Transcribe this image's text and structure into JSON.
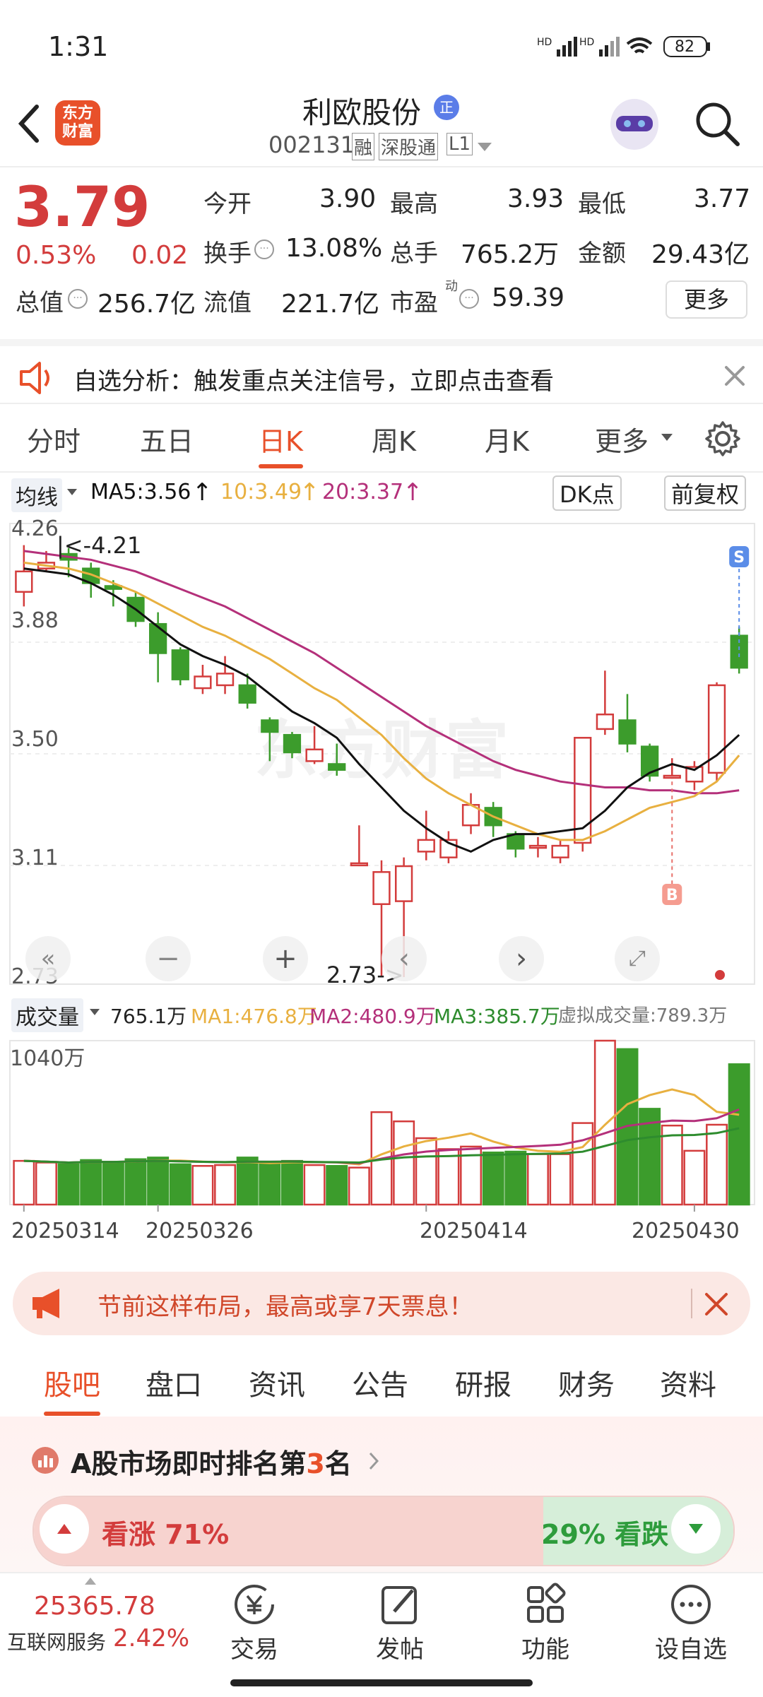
{
  "status_bar": {
    "time": "1:31",
    "signal1": "HD",
    "signal2": "HD",
    "battery": "82"
  },
  "header": {
    "back_icon": "back-arrow-icon",
    "app_logo": "东方财富",
    "stock_name": "利欧股份",
    "name_badge": "正",
    "code": "002131",
    "tags": [
      "融",
      "深股通",
      "L1"
    ],
    "search_icon": "search-icon"
  },
  "quote": {
    "price": "3.79",
    "change_pct": "0.53%",
    "change_abs": "0.02",
    "fields": [
      {
        "label": "今开",
        "value": "3.90",
        "color": "red"
      },
      {
        "label": "最高",
        "value": "3.93",
        "color": "red"
      },
      {
        "label": "最低",
        "value": "3.77",
        "color": "black"
      },
      {
        "label": "换手",
        "value": "13.08%",
        "color": "black"
      },
      {
        "label": "总手",
        "value": "765.2万",
        "color": "black"
      },
      {
        "label": "金额",
        "value": "29.43亿",
        "color": "black"
      },
      {
        "label": "总值",
        "value": "256.7亿",
        "color": "black"
      },
      {
        "label": "流值",
        "value": "221.7亿",
        "color": "black"
      },
      {
        "label": "市盈",
        "value": "59.39",
        "color": "black"
      }
    ],
    "pe_sup": "动",
    "more_label": "更多"
  },
  "analysis_banner": {
    "text": "自选分析：触发重点关注信号，立即点击查看"
  },
  "ktabs": {
    "items": [
      "分时",
      "五日",
      "日K",
      "周K",
      "月K",
      "更多"
    ],
    "active": "日K"
  },
  "ma_row": {
    "selector": "均线",
    "ma5": "MA5:3.56",
    "ma10": "10:3.49",
    "ma20": "20:3.37",
    "dk": "DK点",
    "fq": "前复权"
  },
  "chart_labels": {
    "y_ticks": [
      "4.26",
      "3.88",
      "3.50",
      "3.11",
      "2.73"
    ],
    "high_note": "4.21",
    "low_note": "2.73->",
    "sell_marker": "S",
    "buy_marker": "B"
  },
  "vol_row": {
    "selector": "成交量",
    "vol": "765.1万",
    "ma1": "MA1:476.8万",
    "ma2": "MA2:480.9万",
    "ma3": "MA3:385.7万",
    "virtual": "虚拟成交量:789.3万",
    "vol_tick": "1040万"
  },
  "dates": [
    "20250314",
    "20250326",
    "20250414",
    "20250430"
  ],
  "colors": {
    "up": "#d33c3c",
    "down": "#3c9c2c",
    "ma5": "#111111",
    "ma10": "#e8b040",
    "ma20": "#b4307a",
    "accent": "#e8502a"
  },
  "chart_data": {
    "type": "candlestick",
    "ylim": [
      2.73,
      4.26
    ],
    "candles": [
      {
        "o": 4.05,
        "c": 4.12,
        "h": 4.21,
        "l": 4.0
      },
      {
        "o": 4.13,
        "c": 4.15,
        "h": 4.19,
        "l": 4.12
      },
      {
        "o": 4.18,
        "c": 4.16,
        "h": 4.2,
        "l": 4.1
      },
      {
        "o": 4.13,
        "c": 4.08,
        "h": 4.15,
        "l": 4.03
      },
      {
        "o": 4.07,
        "c": 4.06,
        "h": 4.09,
        "l": 4.0
      },
      {
        "o": 4.03,
        "c": 3.95,
        "h": 4.05,
        "l": 3.93
      },
      {
        "o": 3.94,
        "c": 3.84,
        "h": 3.98,
        "l": 3.74
      },
      {
        "o": 3.85,
        "c": 3.75,
        "h": 3.86,
        "l": 3.73
      },
      {
        "o": 3.72,
        "c": 3.76,
        "h": 3.8,
        "l": 3.7
      },
      {
        "o": 3.73,
        "c": 3.77,
        "h": 3.83,
        "l": 3.7
      },
      {
        "o": 3.73,
        "c": 3.67,
        "h": 3.77,
        "l": 3.65
      },
      {
        "o": 3.61,
        "c": 3.57,
        "h": 3.62,
        "l": 3.47
      },
      {
        "o": 3.56,
        "c": 3.5,
        "h": 3.57,
        "l": 3.48
      },
      {
        "o": 3.47,
        "c": 3.51,
        "h": 3.59,
        "l": 3.46
      },
      {
        "o": 3.46,
        "c": 3.44,
        "h": 3.53,
        "l": 3.42
      },
      {
        "o": 3.12,
        "c": 3.12,
        "h": 3.25,
        "l": 3.11
      },
      {
        "o": 2.98,
        "c": 3.09,
        "h": 3.13,
        "l": 2.73
      },
      {
        "o": 2.99,
        "c": 3.11,
        "h": 3.14,
        "l": 2.73
      },
      {
        "o": 3.16,
        "c": 3.2,
        "h": 3.3,
        "l": 3.13
      },
      {
        "o": 3.14,
        "c": 3.2,
        "h": 3.23,
        "l": 3.12
      },
      {
        "o": 3.25,
        "c": 3.32,
        "h": 3.36,
        "l": 3.22
      },
      {
        "o": 3.31,
        "c": 3.25,
        "h": 3.33,
        "l": 3.21
      },
      {
        "o": 3.22,
        "c": 3.17,
        "h": 3.23,
        "l": 3.14
      },
      {
        "o": 3.18,
        "c": 3.18,
        "h": 3.21,
        "l": 3.14
      },
      {
        "o": 3.14,
        "c": 3.18,
        "h": 3.2,
        "l": 3.12
      },
      {
        "o": 3.19,
        "c": 3.55,
        "h": 3.55,
        "l": 3.16
      },
      {
        "o": 3.58,
        "c": 3.63,
        "h": 3.78,
        "l": 3.56
      },
      {
        "o": 3.61,
        "c": 3.53,
        "h": 3.7,
        "l": 3.5
      },
      {
        "o": 3.52,
        "c": 3.42,
        "h": 3.53,
        "l": 3.4
      },
      {
        "o": 3.42,
        "c": 3.42,
        "h": 3.48,
        "l": 3.41
      },
      {
        "o": 3.4,
        "c": 3.45,
        "h": 3.47,
        "l": 3.37
      },
      {
        "o": 3.43,
        "c": 3.73,
        "h": 3.74,
        "l": 3.4
      },
      {
        "o": 3.9,
        "c": 3.79,
        "h": 3.93,
        "l": 3.77
      }
    ],
    "ma5": [
      4.13,
      4.12,
      4.11,
      4.08,
      4.04,
      3.99,
      3.93,
      3.87,
      3.83,
      3.8,
      3.76,
      3.7,
      3.64,
      3.6,
      3.55,
      3.46,
      3.38,
      3.3,
      3.24,
      3.19,
      3.16,
      3.2,
      3.22,
      3.22,
      3.23,
      3.24,
      3.3,
      3.38,
      3.43,
      3.46,
      3.44,
      3.49,
      3.56
    ],
    "ma10": [
      4.15,
      4.14,
      4.13,
      4.11,
      4.08,
      4.05,
      4.01,
      3.97,
      3.93,
      3.9,
      3.86,
      3.82,
      3.77,
      3.72,
      3.68,
      3.62,
      3.56,
      3.48,
      3.41,
      3.36,
      3.32,
      3.28,
      3.25,
      3.22,
      3.2,
      3.2,
      3.23,
      3.27,
      3.31,
      3.33,
      3.35,
      3.4,
      3.49
    ],
    "ma20": [
      4.19,
      4.18,
      4.17,
      4.16,
      4.14,
      4.12,
      4.09,
      4.06,
      4.03,
      4.0,
      3.96,
      3.92,
      3.88,
      3.84,
      3.79,
      3.74,
      3.69,
      3.64,
      3.59,
      3.55,
      3.51,
      3.47,
      3.44,
      3.42,
      3.4,
      3.39,
      3.38,
      3.38,
      3.37,
      3.37,
      3.36,
      3.36,
      3.37
    ],
    "volume": [
      520,
      500,
      480,
      530,
      510,
      540,
      560,
      480,
      460,
      470,
      560,
      500,
      520,
      470,
      460,
      440,
      1100,
      990,
      790,
      660,
      690,
      620,
      630,
      600,
      600,
      970,
      1950,
      1850,
      1140,
      940,
      640,
      950,
      1670
    ]
  },
  "promo": {
    "text": "节前这样布局，最高或享7天票息！"
  },
  "subtabs": {
    "items": [
      "股吧",
      "盘口",
      "资讯",
      "公告",
      "研报",
      "财务",
      "资料"
    ],
    "active": "股吧"
  },
  "ranking": {
    "prefix": "A股市场即时排名第",
    "rank": "3",
    "suffix": "名",
    "up_label": "看涨 71%",
    "down_label": "29% 看跌",
    "up_pct": 71
  },
  "bottom": {
    "index_value": "25365.78",
    "index_name": "互联网服务",
    "index_change": "2.42%",
    "nav": [
      {
        "label": "交易",
        "icon": "yen-circle-icon"
      },
      {
        "label": "发帖",
        "icon": "edit-icon"
      },
      {
        "label": "功能",
        "icon": "grid-icon"
      },
      {
        "label": "设自选",
        "icon": "more-dots-icon"
      }
    ]
  }
}
